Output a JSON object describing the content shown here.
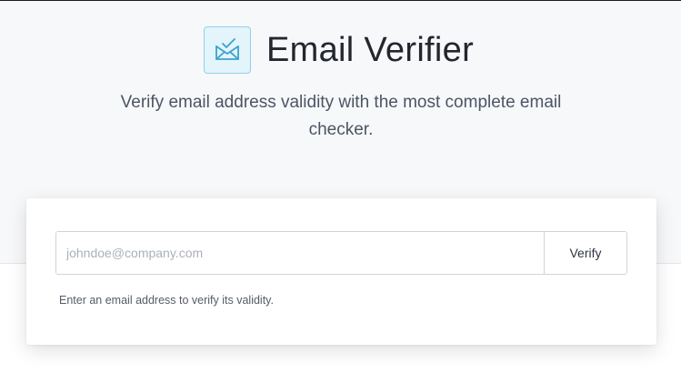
{
  "header": {
    "title": "Email Verifier",
    "subtitle": "Verify email address validity with the most complete email checker.",
    "logo_icon": "envelope-check-icon"
  },
  "form": {
    "email_value": "",
    "email_placeholder": "johndoe@company.com",
    "verify_label": "Verify",
    "helper_text": "Enter an email address to verify its validity."
  },
  "colors": {
    "hero_background": "#f7f8fa",
    "logo_border": "#8fd2ea",
    "logo_fill": "#e3f4fb",
    "logo_icon": "#3aa3cf"
  }
}
